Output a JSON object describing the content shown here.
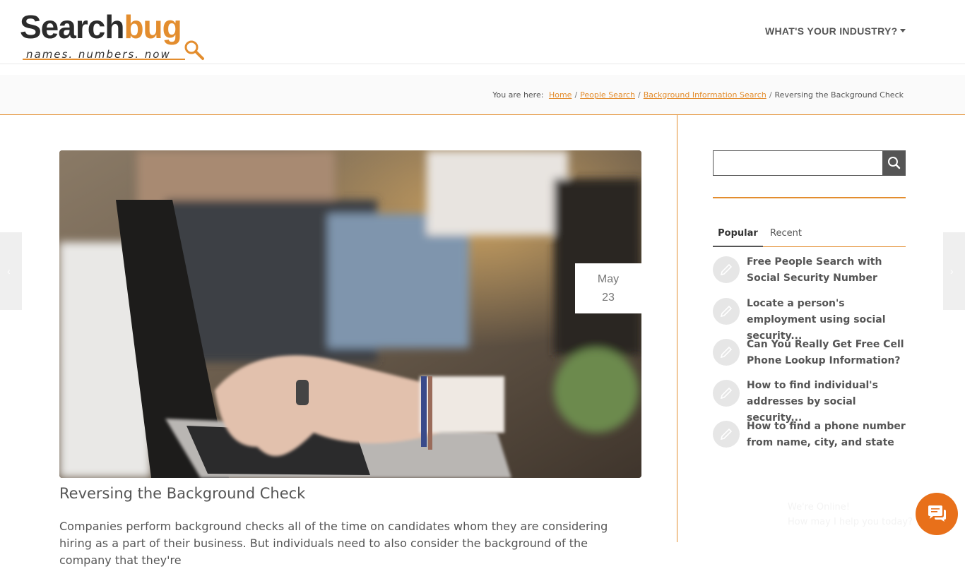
{
  "logo": {
    "word_dark": "Search",
    "word_orange": "bug",
    "tagline": "names. numbers. now"
  },
  "nav": {
    "industry_label": "WHAT'S YOUR INDUSTRY?"
  },
  "breadcrumb": {
    "prefix": "You are here:",
    "items": [
      "Home",
      "People Search",
      "Background Information Search"
    ],
    "current": "Reversing the Background Check"
  },
  "post": {
    "date_month": "May",
    "date_day": "23",
    "title": "Reversing the Background Check",
    "excerpt": "Companies perform background checks all of the time on candidates whom they are considering hiring as a part of their business. But individuals need to also consider the background of the company that they're"
  },
  "sidebar": {
    "search": {
      "placeholder": ""
    },
    "tabs": [
      "Popular",
      "Recent"
    ],
    "popular": [
      "Free People Search with Social Security Number",
      "Locate a person's employment using social security...",
      "Can You Really Get Free Cell Phone Lookup Information?",
      "How to find individual's addresses by social security...",
      "How to find a phone number from name, city, and state"
    ]
  },
  "chat": {
    "line1": "We're Online!",
    "line2": "How may I help you today?"
  },
  "colors": {
    "accent": "#e38d2e",
    "chat": "#e8701a",
    "text": "#555555"
  }
}
